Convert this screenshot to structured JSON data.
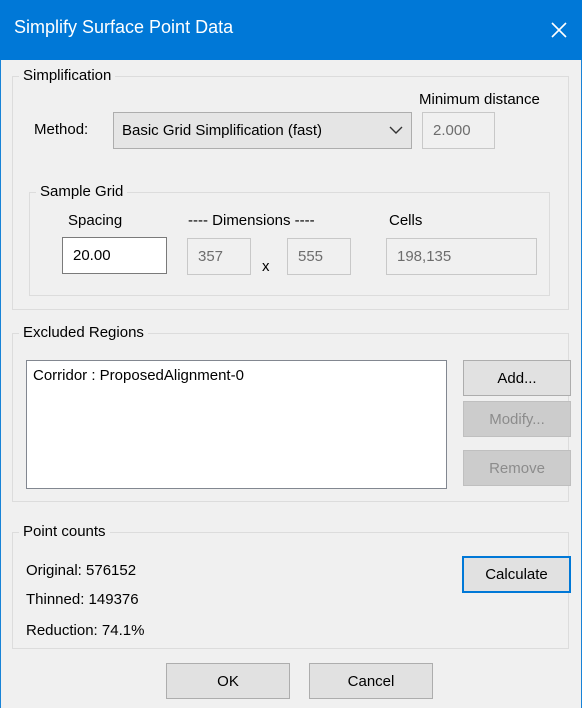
{
  "window": {
    "title": "Simplify Surface Point Data"
  },
  "simplification": {
    "legend": "Simplification",
    "method_label": "Method:",
    "method_value": "Basic Grid Simplification (fast)",
    "min_distance_label": "Minimum distance",
    "min_distance_value": "2.000"
  },
  "sample_grid": {
    "legend": "Sample Grid",
    "spacing_label": "Spacing",
    "dimensions_label": "---- Dimensions ----",
    "cells_label": "Cells",
    "spacing_value": "20.00",
    "dim_x": "357",
    "dim_sep": "x",
    "dim_y": "555",
    "cells_value": "198,135"
  },
  "excluded": {
    "legend": "Excluded Regions",
    "items": [
      "Corridor : ProposedAlignment-0"
    ],
    "add_label": "Add...",
    "modify_label": "Modify...",
    "remove_label": "Remove"
  },
  "point_counts": {
    "legend": "Point counts",
    "original": "Original: 576152",
    "thinned": "Thinned: 149376",
    "reduction": "Reduction: 74.1%",
    "calculate_label": "Calculate"
  },
  "footer": {
    "ok_label": "OK",
    "cancel_label": "Cancel"
  }
}
